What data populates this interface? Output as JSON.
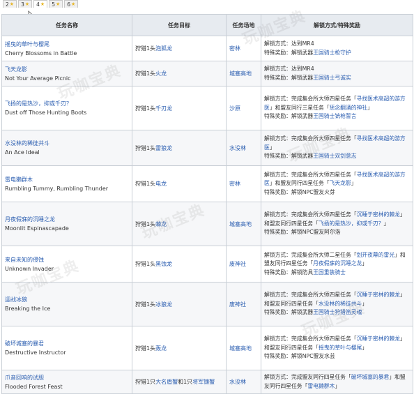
{
  "tabs": [
    {
      "label": "2",
      "active": false
    },
    {
      "label": "3",
      "active": false
    },
    {
      "label": "4",
      "active": true
    },
    {
      "label": "5",
      "active": false
    },
    {
      "label": "6",
      "active": false
    }
  ],
  "watermark": {
    "text": "玩咖宝典"
  },
  "table": {
    "headers": {
      "name": "任务名称",
      "target": "任务目标",
      "location": "任务场地",
      "reward": "解锁方式/特殊奖励"
    },
    "rows": [
      {
        "cn": "摇曳的草叶与樱尾",
        "en": "Cherry Blossoms in Battle",
        "target_pre": "狩猎1头",
        "target_link": "泡狐龙",
        "target_mid": "",
        "target_link2": "",
        "location": "密林",
        "reward": [
          [
            {
              "t": "解锁方式：达到MR4",
              "link": false
            }
          ],
          [
            {
              "t": "特殊奖励：解锁武器",
              "link": false
            },
            {
              "t": "王国骑士枪守护",
              "link": true
            }
          ]
        ]
      },
      {
        "cn": "飞天龙影",
        "en": "Not Your Average Picnic",
        "target_pre": "狩猎1头",
        "target_link": "火龙",
        "target_mid": "",
        "target_link2": "",
        "location": "城塞高地",
        "reward": [
          [
            {
              "t": "解锁方式：达到MR4",
              "link": false
            }
          ],
          [
            {
              "t": "特殊奖励：解锁武器",
              "link": false
            },
            {
              "t": "王国骑士弓诚实",
              "link": true
            }
          ]
        ]
      },
      {
        "cn": "飞扬的是热沙，抑或千刃？",
        "en": "Dust off Those Hunting Boots",
        "target_pre": "狩猎1头",
        "target_link": "千刃龙",
        "target_mid": "",
        "target_link2": "",
        "location": "沙原",
        "reward": [
          [
            {
              "t": "解锁方式：完成集会所大师四星任务「",
              "link": false
            },
            {
              "t": "寻找医术高超的游方医",
              "link": true
            },
            {
              "t": "」和盟友同行三星任务「",
              "link": false
            },
            {
              "t": "惩念翻涌的神社",
              "link": true
            },
            {
              "t": "」",
              "link": false
            }
          ],
          [
            {
              "t": "特殊奖励：解锁武器",
              "link": false
            },
            {
              "t": "王国骑士铳枪誓言",
              "link": true
            }
          ]
        ]
      },
      {
        "cn": "水没林的稀徒共斗",
        "en": "An Ace Ideal",
        "target_pre": "狩猎1头",
        "target_link": "雷狼龙",
        "target_mid": "",
        "target_link2": "",
        "location": "水没林",
        "reward": [
          [
            {
              "t": "解锁方式：完成集会所大师四星任务「",
              "link": false
            },
            {
              "t": "寻找医术高超的游方医",
              "link": true
            },
            {
              "t": "」",
              "link": false
            }
          ],
          [
            {
              "t": "特殊奖励：解锁武器",
              "link": false
            },
            {
              "t": "王国骑士双剑意志",
              "link": true
            }
          ]
        ]
      },
      {
        "cn": "雷电獭群木",
        "en": "Rumbling Tummy, Rumbling Thunder",
        "target_pre": "狩猎1头",
        "target_link": "电龙",
        "target_mid": "",
        "target_link2": "",
        "location": "密林",
        "reward": [
          [
            {
              "t": "解锁方式：完成集会所大师四星任务「",
              "link": false
            },
            {
              "t": "寻找医术高超的游方医",
              "link": true
            },
            {
              "t": "」和盟友同行四星任务「",
              "link": false
            },
            {
              "t": "飞天龙影",
              "link": true
            },
            {
              "t": "」",
              "link": false
            }
          ],
          [
            {
              "t": "特殊奖励：解锁NPC盟友火芽",
              "link": false
            }
          ]
        ]
      },
      {
        "cn": "月夜假寐的沉睡之龙",
        "en": "Moonlit Espinascapade",
        "target_pre": "狩猎1头",
        "target_link": "棘龙",
        "target_mid": "",
        "target_link2": "",
        "location": "城塞高地",
        "reward": [
          [
            {
              "t": "解锁方式：完成集会所大师四星任务「",
              "link": false
            },
            {
              "t": "沉睡于密林的棘龙",
              "link": true
            },
            {
              "t": "」和盟友同行四星任务「",
              "link": false
            },
            {
              "t": "飞扬的是热沙，抑或千刃？",
              "link": true
            },
            {
              "t": "」",
              "link": false
            }
          ],
          [
            {
              "t": "特殊奖励：解锁NPC盟友阿尔洛",
              "link": false
            }
          ]
        ]
      },
      {
        "cn": "来自未知的侵蚀",
        "en": "Unknown Invader",
        "target_pre": "狩猎1头",
        "target_link": "黑蚀龙",
        "target_mid": "",
        "target_link2": "",
        "location": "废神社",
        "reward": [
          [
            {
              "t": "解锁方式：完成集会所大师二星任务「",
              "link": false
            },
            {
              "t": "划开夜幕的雷光",
              "link": true
            },
            {
              "t": "」和盟友同行四星任务「",
              "link": false
            },
            {
              "t": "月夜假寐的沉睡之龙",
              "link": true
            },
            {
              "t": "」",
              "link": false
            }
          ],
          [
            {
              "t": "特殊奖励：解锁防具",
              "link": false
            },
            {
              "t": "王国重装骑士",
              "link": true
            }
          ]
        ]
      },
      {
        "cn": "迎战冰狼",
        "en": "Breaking the Ice",
        "target_pre": "狩猎1头",
        "target_link": "冰狼龙",
        "target_mid": "",
        "target_link2": "",
        "location": "废神社",
        "reward": [
          [
            {
              "t": "解锁方式：完成集会所大师四星任务「",
              "link": false
            },
            {
              "t": "沉睡于密林的棘龙",
              "link": true
            },
            {
              "t": "」和盟友同行四星任务「",
              "link": false
            },
            {
              "t": "水没林的稀徒共斗",
              "link": true
            },
            {
              "t": "」",
              "link": false
            }
          ],
          [
            {
              "t": "特殊奖励：解锁武器",
              "link": false
            },
            {
              "t": "王国骑士狩猎笛灵魂",
              "link": true
            }
          ]
        ]
      },
      {
        "cn": "破坏城塞的暴君",
        "en": "Destructive Instructor",
        "target_pre": "狩猎1头",
        "target_link": "轰龙",
        "target_mid": "",
        "target_link2": "",
        "location": "城塞高地",
        "reward": [
          [
            {
              "t": "解锁方式：完成集会所大师四星任务「",
              "link": false
            },
            {
              "t": "沉睡于密林的棘龙",
              "link": true
            },
            {
              "t": "」和盟友同行四星任务「",
              "link": false
            },
            {
              "t": "摇曳的草叶与樱尾",
              "link": true
            },
            {
              "t": "」",
              "link": false
            }
          ],
          [
            {
              "t": "特殊奖励：解锁NPC盟友水芸",
              "link": false
            }
          ]
        ]
      },
      {
        "cn": "爪音回响的试胆",
        "en": "Flooded Forest Feast",
        "target_pre": "狩猎1只",
        "target_link": "大名盾蟹",
        "target_mid": "和1只",
        "target_link2": "将军镰蟹",
        "location": "水没林",
        "reward": [
          [
            {
              "t": "解锁方式：完成盟友同行四星任务「",
              "link": false
            },
            {
              "t": "破坏城塞的暴君",
              "link": true
            },
            {
              "t": "」和盟友同行四星任务「",
              "link": false
            },
            {
              "t": "雷电獭群木",
              "link": true
            },
            {
              "t": "」",
              "link": false
            }
          ]
        ]
      }
    ]
  }
}
